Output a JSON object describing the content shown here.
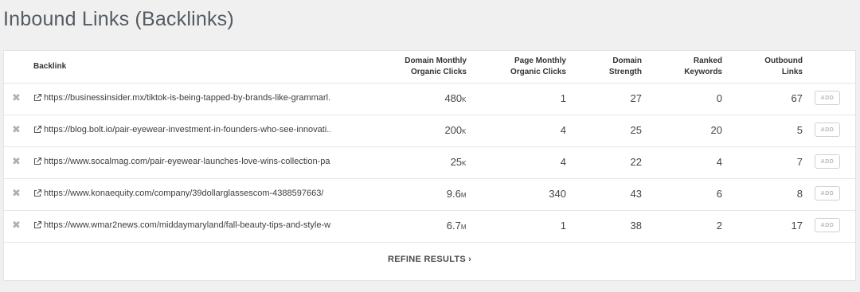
{
  "title": "Inbound Links (Backlinks)",
  "columns": {
    "backlink": "Backlink",
    "domain_monthly_organic_clicks": "Domain Monthly\nOrganic Clicks",
    "page_monthly_organic_clicks": "Page Monthly\nOrganic Clicks",
    "domain_strength": "Domain\nStrength",
    "ranked_keywords": "Ranked\nKeywords",
    "outbound_links": "Outbound\nLinks"
  },
  "rows": [
    {
      "url": "https://businessinsider.mx/tiktok-is-being-tapped-by-brands-like-grammarl...",
      "domain_clicks": "480",
      "domain_clicks_suffix": "K",
      "page_clicks": "1",
      "domain_strength": "27",
      "ranked_keywords": "0",
      "outbound_links": "67",
      "add_label": "ADD"
    },
    {
      "url": "https://blog.bolt.io/pair-eyewear-investment-in-founders-who-see-innovati...",
      "domain_clicks": "200",
      "domain_clicks_suffix": "K",
      "page_clicks": "4",
      "domain_strength": "25",
      "ranked_keywords": "20",
      "outbound_links": "5",
      "add_label": "ADD"
    },
    {
      "url": "https://www.socalmag.com/pair-eyewear-launches-love-wins-collection-par...",
      "domain_clicks": "25",
      "domain_clicks_suffix": "K",
      "page_clicks": "4",
      "domain_strength": "22",
      "ranked_keywords": "4",
      "outbound_links": "7",
      "add_label": "ADD"
    },
    {
      "url": "https://www.konaequity.com/company/39dollarglassescom-4388597663/",
      "domain_clicks": "9.6",
      "domain_clicks_suffix": "M",
      "page_clicks": "340",
      "domain_strength": "43",
      "ranked_keywords": "6",
      "outbound_links": "8",
      "add_label": "ADD"
    },
    {
      "url": "https://www.wmar2news.com/middaymaryland/fall-beauty-tips-and-style-w...",
      "domain_clicks": "6.7",
      "domain_clicks_suffix": "M",
      "page_clicks": "1",
      "domain_strength": "38",
      "ranked_keywords": "2",
      "outbound_links": "17",
      "add_label": "ADD"
    }
  ],
  "refine_label": "REFINE RESULTS",
  "refine_chevron": "›"
}
